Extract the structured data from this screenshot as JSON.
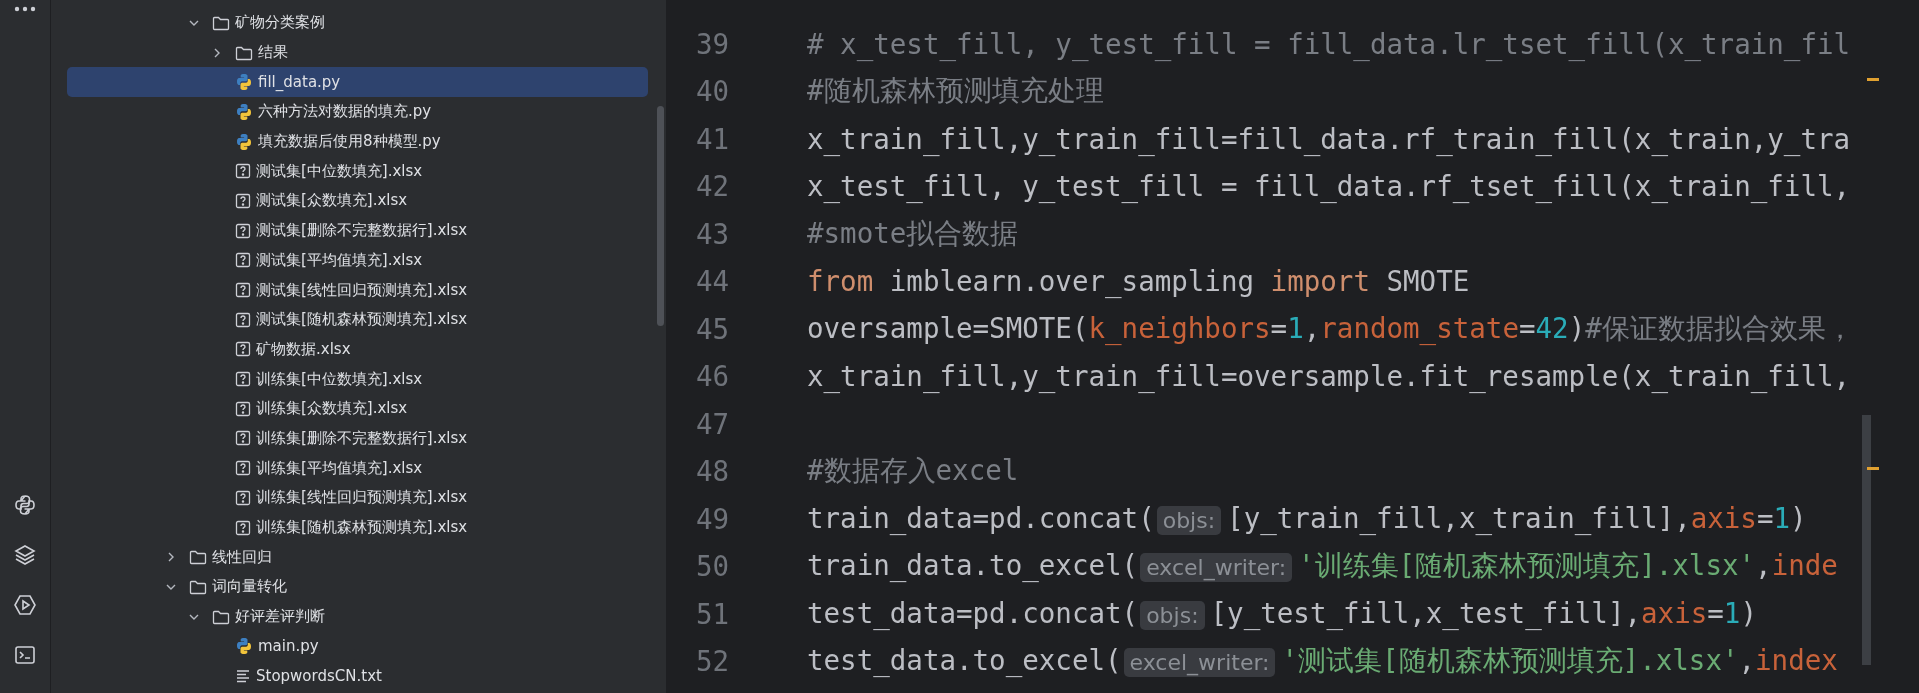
{
  "tree": {
    "items": [
      {
        "kind": "folder",
        "children": [
          {
            "label": "矿物分类案例",
            "kind": "folder",
            "expanded": true,
            "selected": false,
            "children": [
              {
                "label": "结果",
                "kind": "folder",
                "expanded": false,
                "selected": false
              },
              {
                "label": "fill_data.py",
                "kind": "python",
                "selected": true
              },
              {
                "label": "六种方法对数据的填充.py",
                "kind": "python",
                "selected": false
              },
              {
                "label": "填充数据后使用8种模型.py",
                "kind": "python",
                "selected": false
              },
              {
                "label": "测试集[中位数填充].xlsx",
                "kind": "unknown",
                "selected": false
              },
              {
                "label": "测试集[众数填充].xlsx",
                "kind": "unknown",
                "selected": false
              },
              {
                "label": "测试集[删除不完整数据行].xlsx",
                "kind": "unknown",
                "selected": false
              },
              {
                "label": "测试集[平均值填充].xlsx",
                "kind": "unknown",
                "selected": false
              },
              {
                "label": "测试集[线性回归预测填充].xlsx",
                "kind": "unknown",
                "selected": false
              },
              {
                "label": "测试集[随机森林预测填充].xlsx",
                "kind": "unknown",
                "selected": false
              },
              {
                "label": "矿物数据.xlsx",
                "kind": "unknown",
                "selected": false
              },
              {
                "label": "训练集[中位数填充].xlsx",
                "kind": "unknown",
                "selected": false
              },
              {
                "label": "训练集[众数填充].xlsx",
                "kind": "unknown",
                "selected": false
              },
              {
                "label": "训练集[删除不完整数据行].xlsx",
                "kind": "unknown",
                "selected": false
              },
              {
                "label": "训练集[平均值填充].xlsx",
                "kind": "unknown",
                "selected": false
              },
              {
                "label": "训练集[线性回归预测填充].xlsx",
                "kind": "unknown",
                "selected": false
              },
              {
                "label": "训练集[随机森林预测填充].xlsx",
                "kind": "unknown",
                "selected": false
              }
            ]
          }
        ]
      },
      {
        "label": "线性回归",
        "kind": "folder",
        "expanded": false,
        "selected": false
      },
      {
        "label": "词向量转化",
        "kind": "folder",
        "expanded": true,
        "selected": false,
        "children": [
          {
            "label": "好评差评判断",
            "kind": "folder",
            "expanded": true,
            "selected": false,
            "children": [
              {
                "label": "main.py",
                "kind": "python",
                "selected": false
              },
              {
                "label": "StopwordsCN.txt",
                "kind": "text",
                "selected": false
              }
            ]
          }
        ]
      }
    ]
  },
  "editor": {
    "lines": [
      {
        "number": "39",
        "tokens": [
          {
            "kind": "comment",
            "text": "# x_test_fill, y_test_fill = fill_data.lr_tset_fill(x_train_fil"
          }
        ]
      },
      {
        "number": "40",
        "tokens": [
          {
            "kind": "comment",
            "text": "#随机森林预测填充处理"
          }
        ]
      },
      {
        "number": "41",
        "tokens": [
          {
            "kind": "plain",
            "text": "x_train_fill,y_train_fill=fill_data.rf_train_fill(x_train,y_tra"
          }
        ]
      },
      {
        "number": "42",
        "tokens": [
          {
            "kind": "plain",
            "text": "x_test_fill, y_test_fill = fill_data.rf_tset_fill(x_train_fill,"
          }
        ]
      },
      {
        "number": "43",
        "tokens": [
          {
            "kind": "comment",
            "text": "#smote拟合数据"
          }
        ]
      },
      {
        "number": "44",
        "tokens": [
          {
            "kind": "keyword",
            "text": "from"
          },
          {
            "kind": "plain",
            "text": " imblearn.over_sampling "
          },
          {
            "kind": "keyword",
            "text": "import"
          },
          {
            "kind": "plain",
            "text": " SMOTE"
          }
        ]
      },
      {
        "number": "45",
        "tokens": [
          {
            "kind": "plain",
            "text": "oversample=SMOTE("
          },
          {
            "kind": "param",
            "text": "k_neighbors"
          },
          {
            "kind": "plain",
            "text": "="
          },
          {
            "kind": "number",
            "text": "1"
          },
          {
            "kind": "plain",
            "text": ","
          },
          {
            "kind": "param",
            "text": "random_state"
          },
          {
            "kind": "plain",
            "text": "="
          },
          {
            "kind": "number",
            "text": "42"
          },
          {
            "kind": "plain",
            "text": ")"
          },
          {
            "kind": "comment",
            "text": "#保证数据拟合效果，"
          }
        ]
      },
      {
        "number": "46",
        "tokens": [
          {
            "kind": "plain",
            "text": "x_train_fill,y_train_fill=oversample.fit_resample(x_train_fill,"
          }
        ]
      },
      {
        "number": "47"
      },
      {
        "number": "48",
        "tokens": [
          {
            "kind": "comment",
            "text": "#数据存入excel"
          }
        ]
      },
      {
        "number": "49",
        "tokens": [
          {
            "kind": "plain",
            "text": "train_data=pd.concat("
          },
          {
            "kind": "hint",
            "text": "objs:"
          },
          {
            "kind": "plain",
            "text": "[y_train_fill,x_train_fill],"
          },
          {
            "kind": "param",
            "text": "axis"
          },
          {
            "kind": "plain",
            "text": "="
          },
          {
            "kind": "number",
            "text": "1"
          },
          {
            "kind": "plain",
            "text": ")"
          }
        ]
      },
      {
        "number": "50",
        "tokens": [
          {
            "kind": "plain",
            "text": "train_data.to_excel("
          },
          {
            "kind": "hint",
            "text": "excel_writer:"
          },
          {
            "kind": "string",
            "text": "'训练集[随机森林预测填充].xlsx'"
          },
          {
            "kind": "plain",
            "text": ","
          },
          {
            "kind": "param",
            "text": "inde"
          }
        ]
      },
      {
        "number": "51",
        "tokens": [
          {
            "kind": "plain",
            "text": "test_data=pd.concat("
          },
          {
            "kind": "hint",
            "text": "objs:"
          },
          {
            "kind": "plain",
            "text": "[y_test_fill,x_test_fill],"
          },
          {
            "kind": "param",
            "text": "axis"
          },
          {
            "kind": "plain",
            "text": "="
          },
          {
            "kind": "number",
            "text": "1"
          },
          {
            "kind": "plain",
            "text": ")"
          }
        ]
      },
      {
        "number": "52",
        "tokens": [
          {
            "kind": "plain",
            "text": "test_data.to_excel("
          },
          {
            "kind": "hint",
            "text": "excel_writer:"
          },
          {
            "kind": "string",
            "text": "'测试集[随机森林预测填充].xlsx'"
          },
          {
            "kind": "plain",
            "text": ","
          },
          {
            "kind": "param",
            "text": "index"
          }
        ]
      }
    ]
  }
}
